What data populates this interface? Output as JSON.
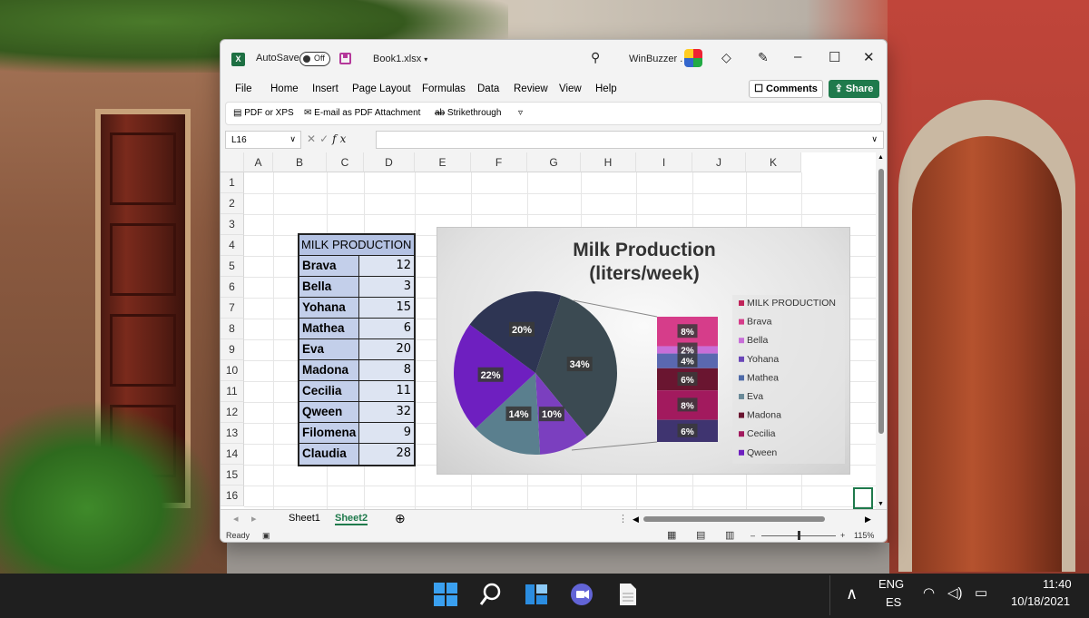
{
  "titlebar": {
    "autosave_label": "AutoSave",
    "autosave_state": "Off",
    "file_name": "Book1.xlsx",
    "user_name": "WinBuzzer .",
    "file_dropdown_icon": "chevron-down-icon"
  },
  "menu": {
    "items": [
      "File",
      "Home",
      "Insert",
      "Page Layout",
      "Formulas",
      "Data",
      "Review",
      "View",
      "Help"
    ],
    "comments_label": "Comments",
    "share_label": "Share"
  },
  "quick_access": {
    "pdf_label": "PDF or XPS",
    "email_label": "E-mail as PDF Attachment",
    "strike_label": "Strikethrough"
  },
  "formula_bar": {
    "name_box": "L16",
    "fx": "fx",
    "value": ""
  },
  "columns": [
    "A",
    "B",
    "C",
    "D",
    "E",
    "F",
    "G",
    "H",
    "I",
    "J",
    "K"
  ],
  "rows": [
    "1",
    "2",
    "3",
    "4",
    "5",
    "6",
    "7",
    "8",
    "9",
    "10",
    "11",
    "12",
    "13",
    "14",
    "15",
    "16"
  ],
  "table": {
    "header": "MILK PRODUCTION",
    "rows": [
      {
        "name": "Brava",
        "value": "12"
      },
      {
        "name": "Bella",
        "value": "3"
      },
      {
        "name": "Yohana",
        "value": "15"
      },
      {
        "name": "Mathea",
        "value": "6"
      },
      {
        "name": "Eva",
        "value": "20"
      },
      {
        "name": "Madona",
        "value": "8"
      },
      {
        "name": "Cecilia",
        "value": "11"
      },
      {
        "name": "Qween",
        "value": "32"
      },
      {
        "name": "Filomena",
        "value": "9"
      },
      {
        "name": "Claudia",
        "value": "28"
      }
    ]
  },
  "chart_data": {
    "type": "pie",
    "title": "Milk Production (liters/week)",
    "title_line1": "Milk Production",
    "title_line2": "(liters/week)",
    "main_pie": [
      {
        "label": "34%",
        "value": 34,
        "color": "#3b4a52"
      },
      {
        "label": "10%",
        "value": 10,
        "color": "#7b3fbf"
      },
      {
        "label": "14%",
        "value": 14,
        "color": "#5a7f8e"
      },
      {
        "label": "22%",
        "value": 22,
        "color": "#6e1fc0"
      },
      {
        "label": "20%",
        "value": 20,
        "color": "#2e3553"
      }
    ],
    "bar_of_pie": [
      {
        "label": "8%",
        "value": 8,
        "color": "#d63d8a"
      },
      {
        "label": "2%",
        "value": 2,
        "color": "#c86ed8"
      },
      {
        "label": "4%",
        "value": 4,
        "color": "#5a68b0"
      },
      {
        "label": "6%",
        "value": 6,
        "color": "#6a1530"
      },
      {
        "label": "8%",
        "value": 8,
        "color": "#a21a5e"
      },
      {
        "label": "6%",
        "value": 6,
        "color": "#3f3470"
      }
    ],
    "legend": [
      {
        "name": "MILK PRODUCTION",
        "color": "#c0245a"
      },
      {
        "name": "Brava",
        "color": "#d63d8a"
      },
      {
        "name": "Bella",
        "color": "#c86ed8"
      },
      {
        "name": "Yohana",
        "color": "#6a46b8"
      },
      {
        "name": "Mathea",
        "color": "#4e6aa8"
      },
      {
        "name": "Eva",
        "color": "#6a8a98"
      },
      {
        "name": "Madona",
        "color": "#6a1530"
      },
      {
        "name": "Cecilia",
        "color": "#a21a5e"
      },
      {
        "name": "Qween",
        "color": "#6e1fc0"
      }
    ]
  },
  "sheets": {
    "tabs": [
      "Sheet1",
      "Sheet2"
    ],
    "active": "Sheet2"
  },
  "status": {
    "ready": "Ready",
    "zoom": "115%"
  },
  "taskbar": {
    "lang1": "ENG",
    "lang2": "ES",
    "time": "11:40",
    "date": "10/18/2021"
  }
}
